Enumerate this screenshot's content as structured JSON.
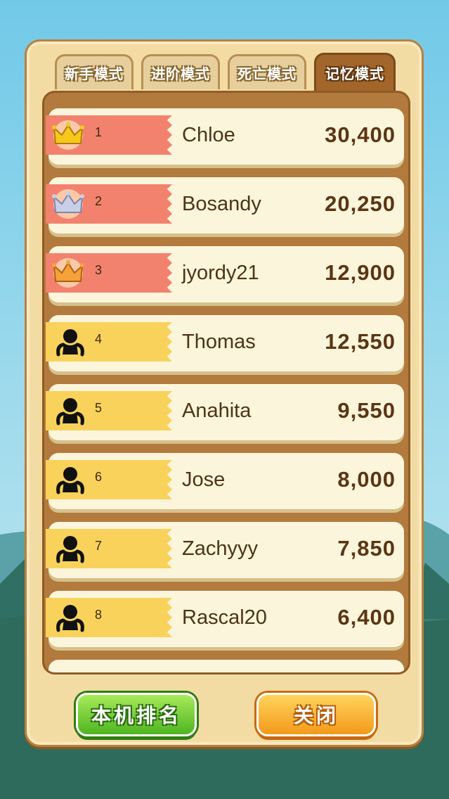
{
  "tabs": [
    {
      "label": "新手模式",
      "active": false
    },
    {
      "label": "进阶模式",
      "active": false
    },
    {
      "label": "死亡模式",
      "active": false
    },
    {
      "label": "记忆模式",
      "active": true
    }
  ],
  "leaderboard": [
    {
      "rank": "1",
      "name": "Chloe",
      "score": "30,400",
      "badge": "gold-crown-icon"
    },
    {
      "rank": "2",
      "name": "Bosandy",
      "score": "20,250",
      "badge": "silver-crown-icon"
    },
    {
      "rank": "3",
      "name": "jyordy21",
      "score": "12,900",
      "badge": "bronze-crown-icon"
    },
    {
      "rank": "4",
      "name": "Thomas",
      "score": "12,550",
      "badge": "silhouette-avatar-icon"
    },
    {
      "rank": "5",
      "name": "Anahita",
      "score": "9,550",
      "badge": "silhouette-avatar-icon"
    },
    {
      "rank": "6",
      "name": "Jose",
      "score": "8,000",
      "badge": "silhouette-avatar-icon"
    },
    {
      "rank": "7",
      "name": "Zachyyy",
      "score": "7,850",
      "badge": "silhouette-avatar-icon"
    },
    {
      "rank": "8",
      "name": "Rascal20",
      "score": "6,400",
      "badge": "silhouette-avatar-icon"
    }
  ],
  "buttons": {
    "local_rank": "本机排名",
    "close": "关闭"
  },
  "colors": {
    "top3_ribbon": "#f2826e",
    "other_ribbon": "#f8d25a",
    "active_tab": "#a3662a",
    "green_button": "#4fb521",
    "orange_button": "#f39a1b"
  }
}
